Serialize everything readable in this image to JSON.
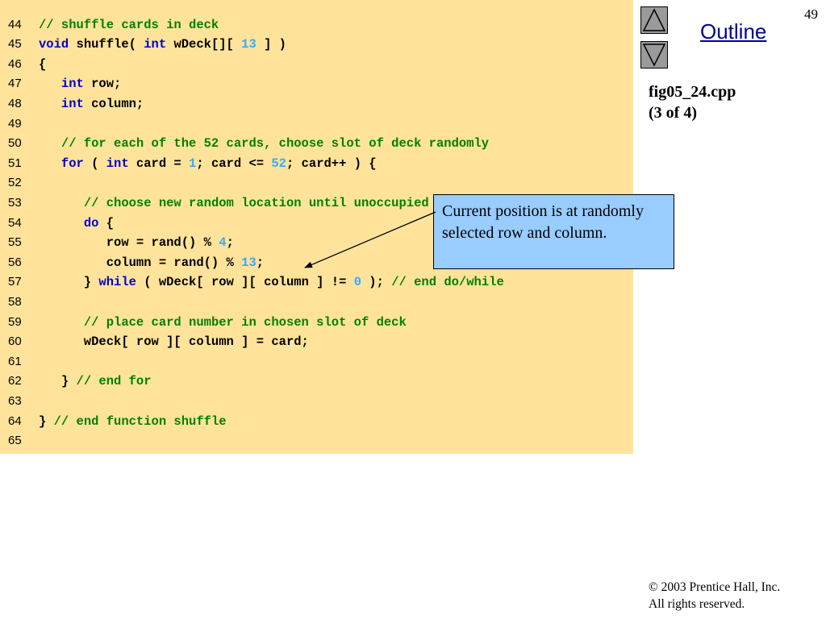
{
  "slide": {
    "number": "49",
    "outline_label": "Outline",
    "file_name": "fig05_24.cpp",
    "part": "(3 of 4)",
    "callout_text": "Current position is at randomly selected row and column.",
    "copyright_line1": "© 2003 Prentice Hall, Inc.",
    "copyright_line2": "All rights reserved."
  },
  "nav": {
    "up_icon": "up-triangle-icon",
    "down_icon": "down-triangle-icon"
  },
  "colors": {
    "code_background": "#ffe39b",
    "comment": "#008000",
    "keyword": "#0000cc",
    "number": "#33aaff",
    "callout_background": "#99ccff",
    "outline_link": "#000099"
  },
  "code_lines": [
    {
      "num": "44",
      "tokens": [
        [
          "comment",
          "// shuffle cards in deck"
        ]
      ]
    },
    {
      "num": "45",
      "tokens": [
        [
          "kw",
          "void"
        ],
        [
          "plain",
          " shuffle( "
        ],
        [
          "kw",
          "int"
        ],
        [
          "plain",
          " wDeck[][ "
        ],
        [
          "num",
          "13"
        ],
        [
          "plain",
          " ] )"
        ]
      ]
    },
    {
      "num": "46",
      "tokens": [
        [
          "plain",
          "{"
        ]
      ]
    },
    {
      "num": "47",
      "tokens": [
        [
          "plain",
          "   "
        ],
        [
          "kw",
          "int"
        ],
        [
          "plain",
          " row;"
        ]
      ]
    },
    {
      "num": "48",
      "tokens": [
        [
          "plain",
          "   "
        ],
        [
          "kw",
          "int"
        ],
        [
          "plain",
          " column;"
        ]
      ]
    },
    {
      "num": "49",
      "tokens": []
    },
    {
      "num": "50",
      "tokens": [
        [
          "plain",
          "   "
        ],
        [
          "comment",
          "// for each of the 52 cards, choose slot of deck randomly"
        ]
      ]
    },
    {
      "num": "51",
      "tokens": [
        [
          "plain",
          "   "
        ],
        [
          "kw",
          "for"
        ],
        [
          "plain",
          " ( "
        ],
        [
          "kw",
          "int"
        ],
        [
          "plain",
          " card = "
        ],
        [
          "num",
          "1"
        ],
        [
          "plain",
          "; card <= "
        ],
        [
          "num",
          "52"
        ],
        [
          "plain",
          "; card++ ) {"
        ]
      ]
    },
    {
      "num": "52",
      "tokens": []
    },
    {
      "num": "53",
      "tokens": [
        [
          "plain",
          "      "
        ],
        [
          "comment",
          "// choose new random location until unoccupied slot found"
        ]
      ]
    },
    {
      "num": "54",
      "tokens": [
        [
          "plain",
          "      "
        ],
        [
          "kw",
          "do"
        ],
        [
          "plain",
          " {"
        ]
      ]
    },
    {
      "num": "55",
      "tokens": [
        [
          "plain",
          "         row = rand() % "
        ],
        [
          "num",
          "4"
        ],
        [
          "plain",
          ";"
        ]
      ]
    },
    {
      "num": "56",
      "tokens": [
        [
          "plain",
          "         column = rand() % "
        ],
        [
          "num",
          "13"
        ],
        [
          "plain",
          ";"
        ]
      ]
    },
    {
      "num": "57",
      "tokens": [
        [
          "plain",
          "      } "
        ],
        [
          "kw",
          "while"
        ],
        [
          "plain",
          " ( wDeck[ row ][ column ] != "
        ],
        [
          "num",
          "0"
        ],
        [
          "plain",
          " ); "
        ],
        [
          "comment",
          "// end do/while"
        ]
      ]
    },
    {
      "num": "58",
      "tokens": []
    },
    {
      "num": "59",
      "tokens": [
        [
          "plain",
          "      "
        ],
        [
          "comment",
          "// place card number in chosen slot of deck"
        ]
      ]
    },
    {
      "num": "60",
      "tokens": [
        [
          "plain",
          "      wDeck[ row ][ column ] = card;"
        ]
      ]
    },
    {
      "num": "61",
      "tokens": []
    },
    {
      "num": "62",
      "tokens": [
        [
          "plain",
          "   } "
        ],
        [
          "comment",
          "// end for"
        ]
      ]
    },
    {
      "num": "63",
      "tokens": []
    },
    {
      "num": "64",
      "tokens": [
        [
          "plain",
          "} "
        ],
        [
          "comment",
          "// end function shuffle"
        ]
      ]
    },
    {
      "num": "65",
      "tokens": []
    }
  ]
}
